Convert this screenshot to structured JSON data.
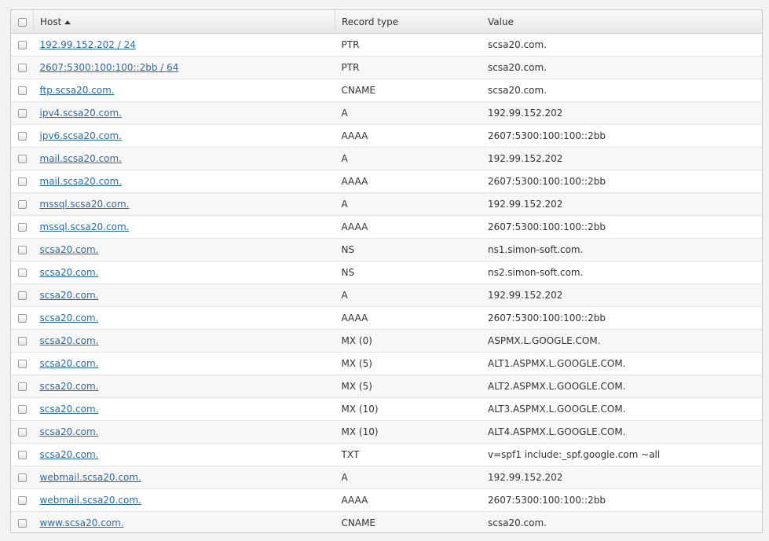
{
  "columns": {
    "host": "Host",
    "record_type": "Record type",
    "value": "Value"
  },
  "sort": {
    "column": "host",
    "direction": "ascending"
  },
  "records": [
    {
      "host": "192.99.152.202 / 24",
      "type": "PTR",
      "value": "scsa20.com."
    },
    {
      "host": "2607:5300:100:100::2bb / 64",
      "type": "PTR",
      "value": "scsa20.com."
    },
    {
      "host": "ftp.scsa20.com.",
      "type": "CNAME",
      "value": "scsa20.com."
    },
    {
      "host": "ipv4.scsa20.com.",
      "type": "A",
      "value": "192.99.152.202"
    },
    {
      "host": "ipv6.scsa20.com.",
      "type": "AAAA",
      "value": "2607:5300:100:100::2bb"
    },
    {
      "host": "mail.scsa20.com.",
      "type": "A",
      "value": "192.99.152.202"
    },
    {
      "host": "mail.scsa20.com.",
      "type": "AAAA",
      "value": "2607:5300:100:100::2bb"
    },
    {
      "host": "mssql.scsa20.com.",
      "type": "A",
      "value": "192.99.152.202"
    },
    {
      "host": "mssql.scsa20.com.",
      "type": "AAAA",
      "value": "2607:5300:100:100::2bb"
    },
    {
      "host": "scsa20.com.",
      "type": "NS",
      "value": "ns1.simon-soft.com."
    },
    {
      "host": "scsa20.com.",
      "type": "NS",
      "value": "ns2.simon-soft.com."
    },
    {
      "host": "scsa20.com.",
      "type": "A",
      "value": "192.99.152.202"
    },
    {
      "host": "scsa20.com.",
      "type": "AAAA",
      "value": "2607:5300:100:100::2bb"
    },
    {
      "host": "scsa20.com.",
      "type": "MX (0)",
      "value": "ASPMX.L.GOOGLE.COM."
    },
    {
      "host": "scsa20.com.",
      "type": "MX (5)",
      "value": "ALT1.ASPMX.L.GOOGLE.COM."
    },
    {
      "host": "scsa20.com.",
      "type": "MX (5)",
      "value": "ALT2.ASPMX.L.GOOGLE.COM."
    },
    {
      "host": "scsa20.com.",
      "type": "MX (10)",
      "value": "ALT3.ASPMX.L.GOOGLE.COM."
    },
    {
      "host": "scsa20.com.",
      "type": "MX (10)",
      "value": "ALT4.ASPMX.L.GOOGLE.COM."
    },
    {
      "host": "scsa20.com.",
      "type": "TXT",
      "value": "v=spf1 include:_spf.google.com ~all"
    },
    {
      "host": "webmail.scsa20.com.",
      "type": "A",
      "value": "192.99.152.202"
    },
    {
      "host": "webmail.scsa20.com.",
      "type": "AAAA",
      "value": "2607:5300:100:100::2bb"
    },
    {
      "host": "www.scsa20.com.",
      "type": "CNAME",
      "value": "scsa20.com."
    }
  ],
  "colors": {
    "link": "#2a6aa8",
    "row_alt": "#f7f7f7",
    "header_bg": "#eeeeee",
    "border": "#c9c9c9"
  }
}
